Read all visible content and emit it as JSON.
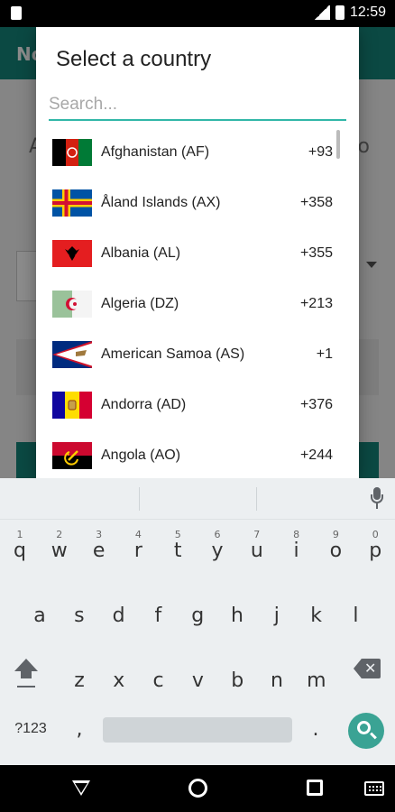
{
  "status_bar": {
    "time": "12:59"
  },
  "background_app": {
    "title": "No",
    "row_text_left": "A",
    "row_text_right": "o"
  },
  "dialog": {
    "title": "Select a country",
    "search": {
      "placeholder": "Search...",
      "value": ""
    },
    "countries": [
      {
        "name": "Afghanistan (AF)",
        "code": "+93"
      },
      {
        "name": "Åland Islands (AX)",
        "code": "+358"
      },
      {
        "name": "Albania (AL)",
        "code": "+355"
      },
      {
        "name": "Algeria (DZ)",
        "code": "+213"
      },
      {
        "name": "American Samoa (AS)",
        "code": "+1"
      },
      {
        "name": "Andorra (AD)",
        "code": "+376"
      },
      {
        "name": "Angola (AO)",
        "code": "+244"
      }
    ]
  },
  "keyboard": {
    "row1": [
      {
        "ch": "q",
        "sup": "1"
      },
      {
        "ch": "w",
        "sup": "2"
      },
      {
        "ch": "e",
        "sup": "3"
      },
      {
        "ch": "r",
        "sup": "4"
      },
      {
        "ch": "t",
        "sup": "5"
      },
      {
        "ch": "y",
        "sup": "6"
      },
      {
        "ch": "u",
        "sup": "7"
      },
      {
        "ch": "i",
        "sup": "8"
      },
      {
        "ch": "o",
        "sup": "9"
      },
      {
        "ch": "p",
        "sup": "0"
      }
    ],
    "row2": [
      "a",
      "s",
      "d",
      "f",
      "g",
      "h",
      "j",
      "k",
      "l"
    ],
    "row3": [
      "z",
      "x",
      "c",
      "v",
      "b",
      "n",
      "m"
    ],
    "symbols_label": "?123",
    "comma": ",",
    "period": "."
  },
  "colors": {
    "accent": "#31b7a8",
    "app_bar": "#14857a",
    "search_key": "#3aa394"
  }
}
